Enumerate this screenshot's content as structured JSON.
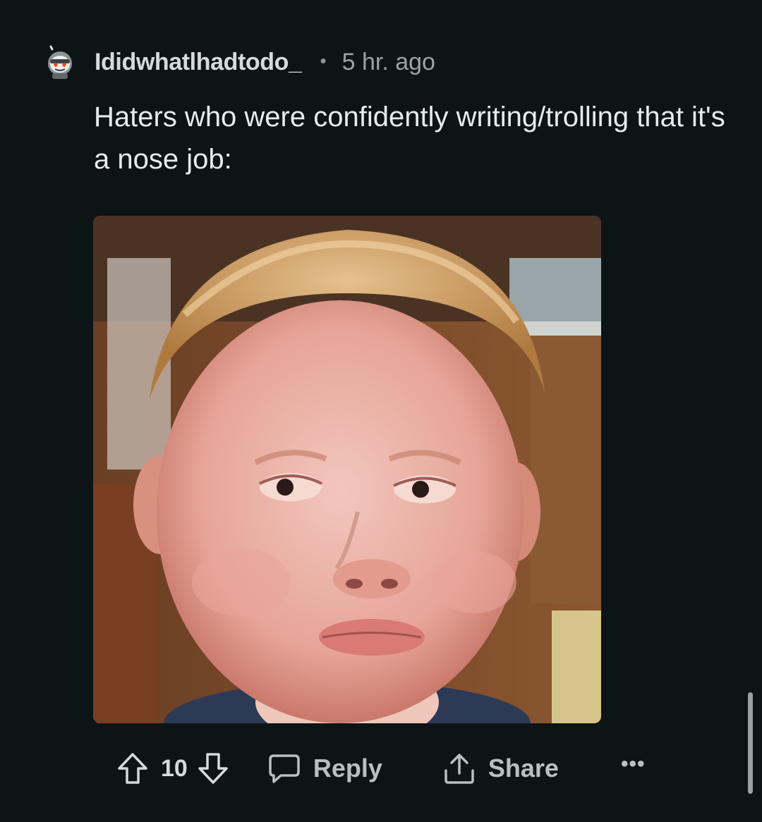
{
  "comment": {
    "username": "Ididwhatlhadtodo_",
    "separator": "•",
    "timestamp": "5 hr. ago",
    "body": "Haters who were confidently writing/trolling that it's a nose job:",
    "image_description": "meme-photo-child",
    "actions": {
      "vote_count": "10",
      "reply_label": "Reply",
      "share_label": "Share",
      "more_label": "•••"
    }
  },
  "colors": {
    "background": "#0c1416",
    "text_primary": "#e8ebed",
    "text_muted": "#9aa3a6"
  }
}
